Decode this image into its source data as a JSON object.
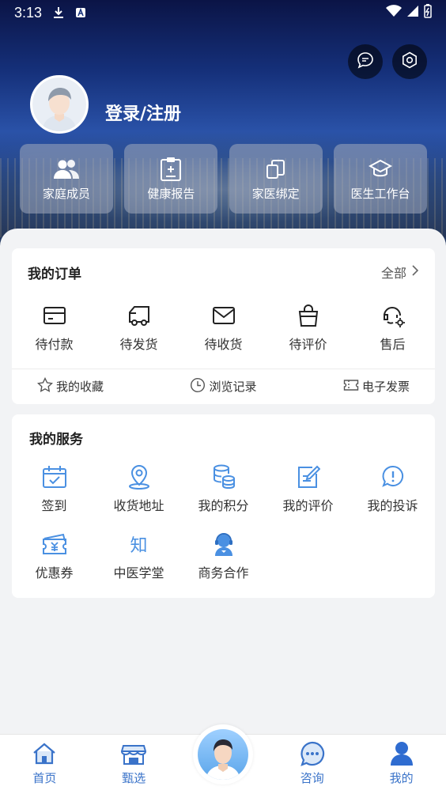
{
  "status_bar": {
    "time": "3:13"
  },
  "header": {
    "login_label": "登录/注册",
    "quick_tiles": [
      {
        "label": "家庭成员",
        "icon": "family-icon"
      },
      {
        "label": "健康报告",
        "icon": "report-clipboard-icon"
      },
      {
        "label": "家医绑定",
        "icon": "bind-cards-icon"
      },
      {
        "label": "医生工作台",
        "icon": "graduation-cap-icon"
      }
    ]
  },
  "orders": {
    "title": "我的订单",
    "all_label": "全部",
    "items": [
      {
        "label": "待付款",
        "icon": "card-icon"
      },
      {
        "label": "待发货",
        "icon": "truck-icon"
      },
      {
        "label": "待收货",
        "icon": "envelope-icon"
      },
      {
        "label": "待评价",
        "icon": "bag-icon"
      },
      {
        "label": "售后",
        "icon": "support-gear-icon"
      }
    ],
    "sub_links": [
      {
        "label": "我的收藏",
        "icon": "star-icon"
      },
      {
        "label": "浏览记录",
        "icon": "clock-icon"
      },
      {
        "label": "电子发票",
        "icon": "ticket-icon"
      }
    ]
  },
  "services": {
    "title": "我的服务",
    "row1": [
      {
        "label": "签到",
        "icon": "calendar-check-icon"
      },
      {
        "label": "收货地址",
        "icon": "location-pin-icon"
      },
      {
        "label": "我的积分",
        "icon": "coins-stack-icon"
      },
      {
        "label": "我的评价",
        "icon": "edit-note-icon"
      },
      {
        "label": "我的投诉",
        "icon": "alert-bubble-icon"
      }
    ],
    "row2": [
      {
        "label": "优惠券",
        "icon": "coupon-yuan-icon"
      },
      {
        "label": "中医学堂",
        "icon": "zhi-glyph-icon",
        "glyph": "知"
      },
      {
        "label": "商务合作",
        "icon": "customer-service-icon"
      }
    ]
  },
  "bottom_nav": [
    {
      "label": "首页",
      "icon": "home-icon"
    },
    {
      "label": "甄选",
      "icon": "store-icon"
    },
    {
      "label": "",
      "icon": "doctor-avatar-icon"
    },
    {
      "label": "咨询",
      "icon": "chat-bubble-icon"
    },
    {
      "label": "我的",
      "icon": "person-icon"
    }
  ],
  "colors": {
    "accent": "#3a73c9",
    "icon_blue": "#4a90e2",
    "card_bg": "#ffffff",
    "page_bg": "#f2f3f5"
  }
}
